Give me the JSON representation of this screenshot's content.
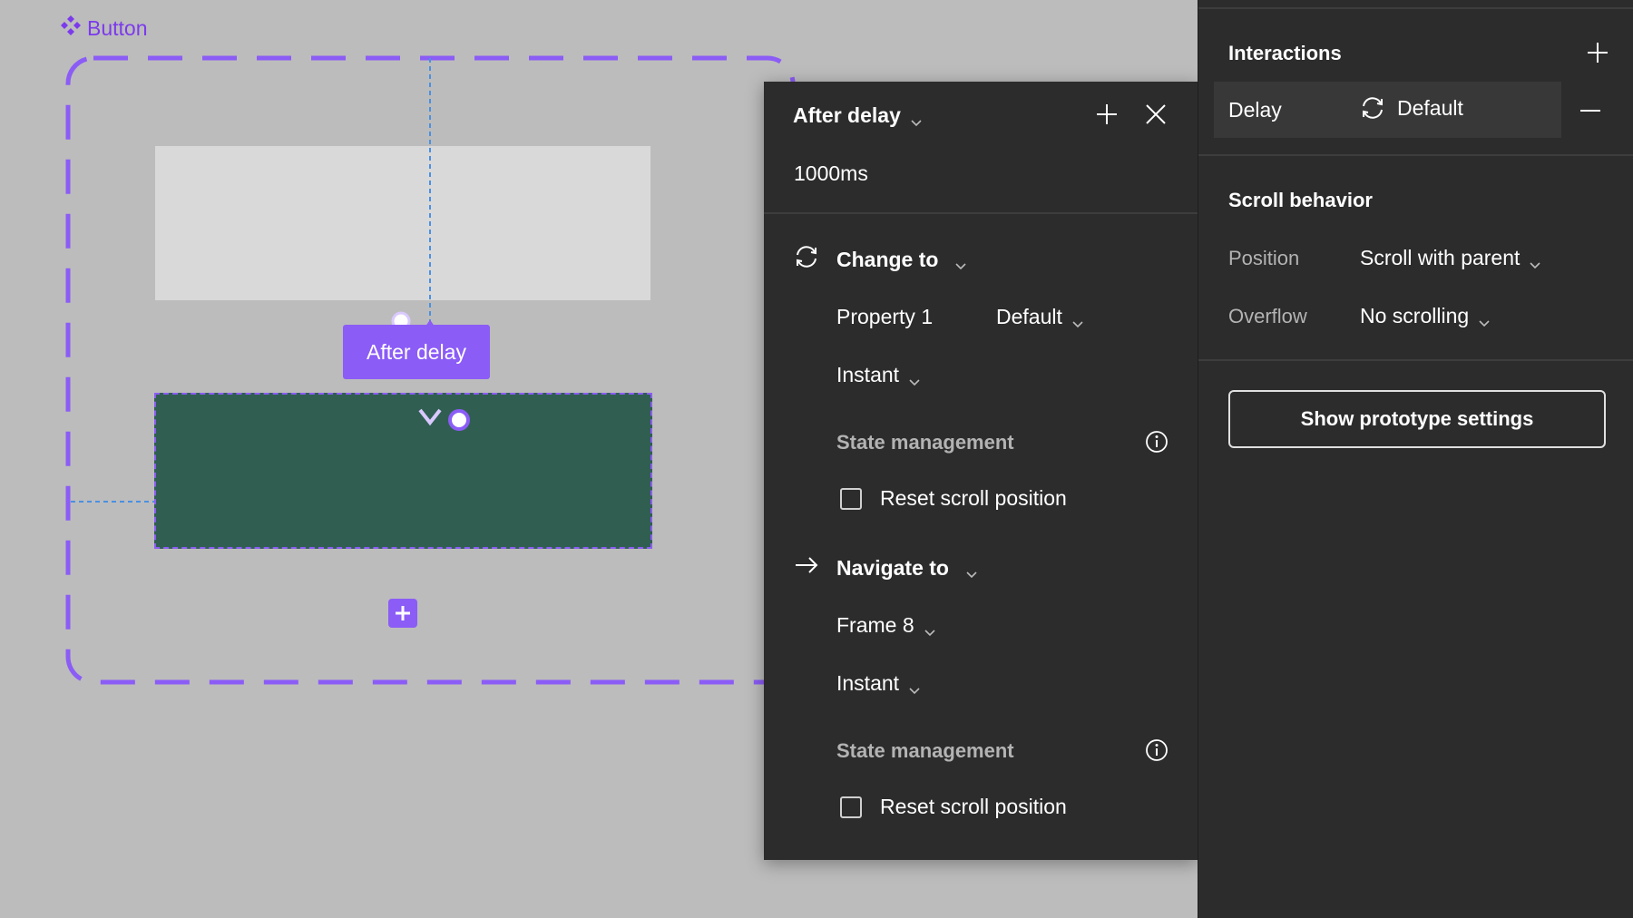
{
  "canvas": {
    "component_name": "Button",
    "trigger_pill_label": "After delay"
  },
  "popover": {
    "trigger": "After delay",
    "delay_value": "1000ms",
    "actions": [
      {
        "type": "Change to",
        "property_label": "Property 1",
        "property_value": "Default",
        "animation": "Instant",
        "state_management_title": "State management",
        "reset_scroll_label": "Reset scroll position"
      },
      {
        "type": "Navigate to",
        "destination": "Frame 8",
        "animation": "Instant",
        "state_management_title": "State management",
        "reset_scroll_label": "Reset scroll position"
      }
    ]
  },
  "panel": {
    "interactions_title": "Interactions",
    "interaction": {
      "trigger": "Delay",
      "action": "Default"
    },
    "scroll_behavior_title": "Scroll behavior",
    "position_label": "Position",
    "position_value": "Scroll with parent",
    "overflow_label": "Overflow",
    "overflow_value": "No scrolling",
    "prototype_button": "Show prototype settings"
  },
  "colors": {
    "accent": "#8b5cf6",
    "canvas_bg": "#bcbcbc",
    "panel_bg": "#2c2c2c",
    "green_variant": "#305f52",
    "light_variant": "#d9d9d9"
  },
  "icons": [
    "component-icon",
    "plus-icon",
    "close-icon",
    "chevron-down-icon",
    "swap-icon",
    "arrow-right-icon",
    "info-icon",
    "minus-icon"
  ]
}
